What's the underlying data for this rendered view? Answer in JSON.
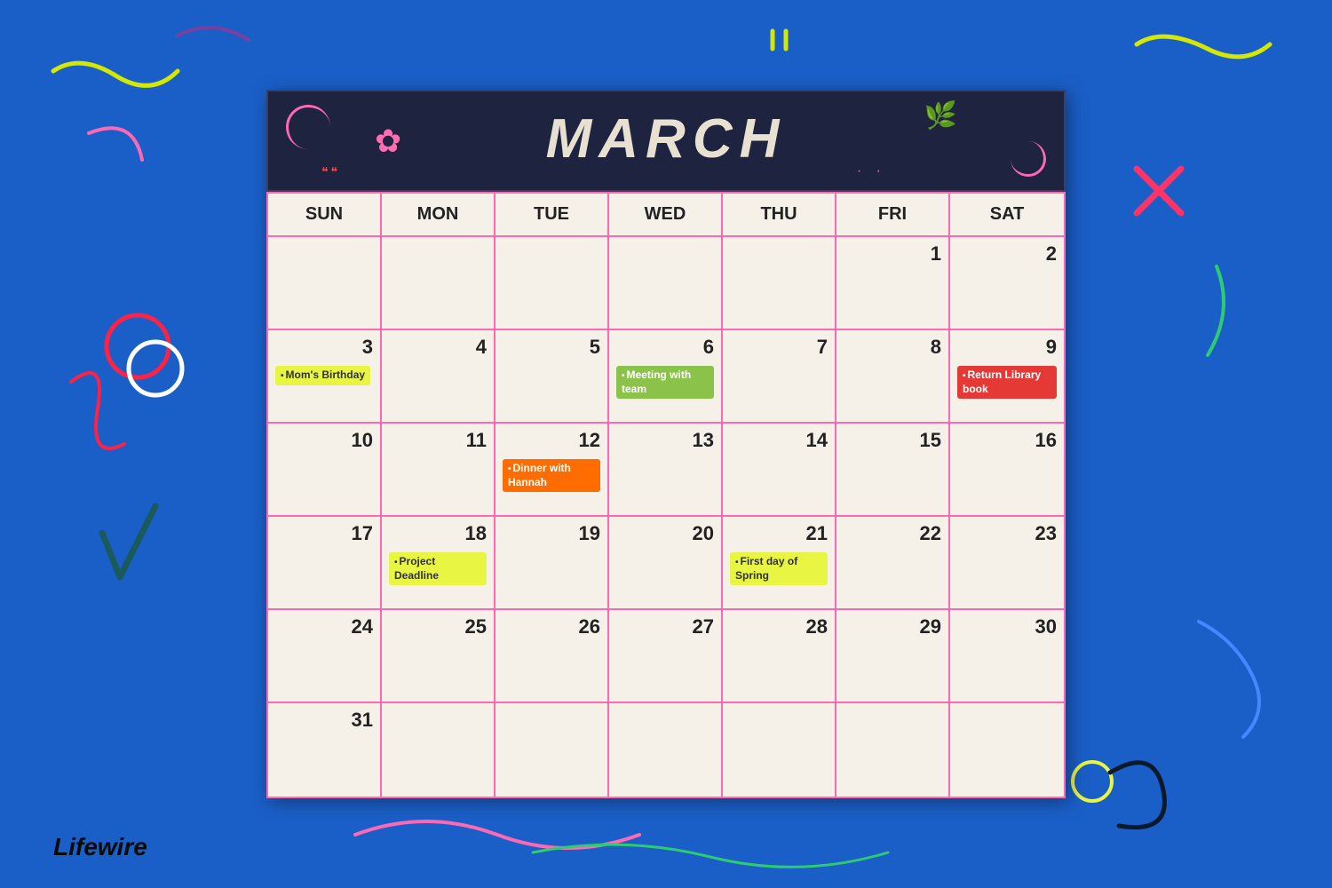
{
  "header": {
    "month": "MARCH"
  },
  "days_of_week": [
    "SUN",
    "MON",
    "TUE",
    "WED",
    "THU",
    "FRI",
    "SAT"
  ],
  "weeks": [
    [
      {
        "day": "",
        "events": []
      },
      {
        "day": "",
        "events": []
      },
      {
        "day": "",
        "events": []
      },
      {
        "day": "",
        "events": []
      },
      {
        "day": "",
        "events": []
      },
      {
        "day": "1",
        "events": []
      },
      {
        "day": "2",
        "events": []
      }
    ],
    [
      {
        "day": "3",
        "events": [
          {
            "label": "Mom's Birthday",
            "color": "yellow"
          }
        ]
      },
      {
        "day": "4",
        "events": []
      },
      {
        "day": "5",
        "events": []
      },
      {
        "day": "6",
        "events": [
          {
            "label": "Meeting with team",
            "color": "green"
          }
        ]
      },
      {
        "day": "7",
        "events": []
      },
      {
        "day": "8",
        "events": []
      },
      {
        "day": "9",
        "events": [
          {
            "label": "Return Library book",
            "color": "red"
          }
        ]
      }
    ],
    [
      {
        "day": "10",
        "events": []
      },
      {
        "day": "11",
        "events": []
      },
      {
        "day": "12",
        "events": [
          {
            "label": "Dinner with Hannah",
            "color": "orange"
          }
        ]
      },
      {
        "day": "13",
        "events": []
      },
      {
        "day": "14",
        "events": []
      },
      {
        "day": "15",
        "events": []
      },
      {
        "day": "16",
        "events": []
      }
    ],
    [
      {
        "day": "17",
        "events": []
      },
      {
        "day": "18",
        "events": [
          {
            "label": "Project Deadline",
            "color": "yellow"
          }
        ]
      },
      {
        "day": "19",
        "events": []
      },
      {
        "day": "20",
        "events": []
      },
      {
        "day": "21",
        "events": [
          {
            "label": "First day of Spring",
            "color": "yellow"
          }
        ]
      },
      {
        "day": "22",
        "events": []
      },
      {
        "day": "23",
        "events": []
      }
    ],
    [
      {
        "day": "24",
        "events": []
      },
      {
        "day": "25",
        "events": []
      },
      {
        "day": "26",
        "events": []
      },
      {
        "day": "27",
        "events": []
      },
      {
        "day": "28",
        "events": []
      },
      {
        "day": "29",
        "events": []
      },
      {
        "day": "30",
        "events": []
      }
    ],
    [
      {
        "day": "31",
        "events": []
      },
      {
        "day": "",
        "events": []
      },
      {
        "day": "",
        "events": []
      },
      {
        "day": "",
        "events": []
      },
      {
        "day": "",
        "events": []
      },
      {
        "day": "",
        "events": []
      },
      {
        "day": "",
        "events": []
      }
    ]
  ],
  "branding": {
    "logo": "Lifewire"
  },
  "colors": {
    "yellow": "#e8f542",
    "green": "#8bc34a",
    "red": "#e53935",
    "orange": "#ff6d00"
  }
}
